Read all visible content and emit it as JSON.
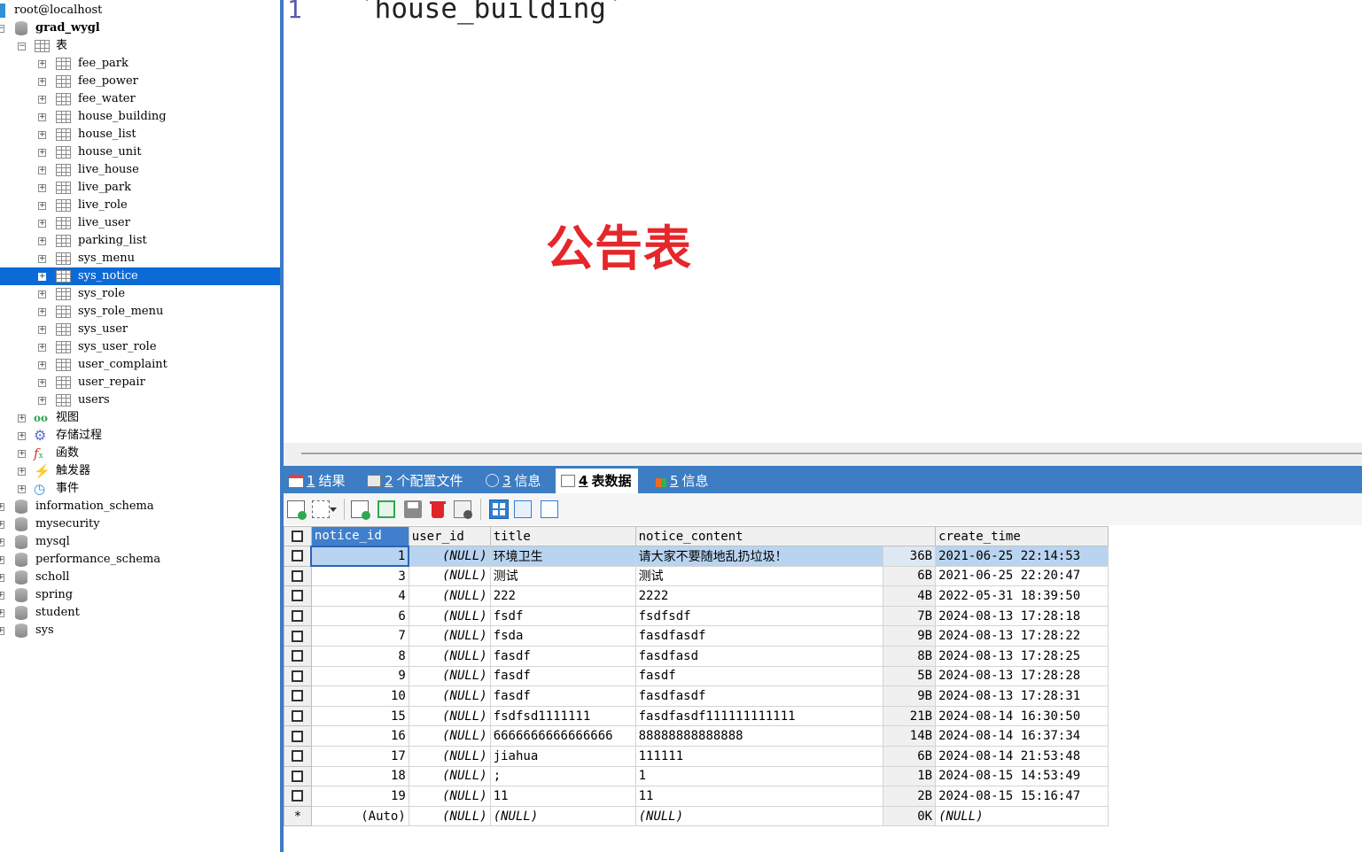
{
  "tree": {
    "connection": "root@localhost",
    "database": "grad_wygl",
    "tables_folder": "表",
    "tables": [
      "fee_park",
      "fee_power",
      "fee_water",
      "house_building",
      "house_list",
      "house_unit",
      "live_house",
      "live_park",
      "live_role",
      "live_user",
      "parking_list",
      "sys_menu",
      "sys_notice",
      "sys_role",
      "sys_role_menu",
      "sys_user",
      "sys_user_role",
      "user_complaint",
      "user_repair",
      "users"
    ],
    "selected_table": "sys_notice",
    "folders": [
      {
        "label": "视图",
        "icon": "view-icon"
      },
      {
        "label": "存储过程",
        "icon": "gear-icon"
      },
      {
        "label": "函数",
        "icon": "function-icon"
      },
      {
        "label": "触发器",
        "icon": "lightning-icon"
      },
      {
        "label": "事件",
        "icon": "clock-icon"
      }
    ],
    "other_databases": [
      "information_schema",
      "mysecurity",
      "mysql",
      "performance_schema",
      "scholl",
      "spring",
      "student",
      "sys"
    ]
  },
  "editor": {
    "line_number": "1",
    "sql": "`house_building`",
    "annotation": "公告表"
  },
  "tabs": [
    {
      "num": "1",
      "label": "结果",
      "icon": "result-grid-icon"
    },
    {
      "num": "2",
      "label": "个配置文件",
      "icon": "profile-icon"
    },
    {
      "num": "3",
      "label": "信息",
      "icon": "info-icon"
    },
    {
      "num": "4",
      "label": "表数据",
      "icon": "table-data-icon",
      "active": true
    },
    {
      "num": "5",
      "label": "信息",
      "icon": "info-chart-icon"
    }
  ],
  "toolbar": {
    "icons": [
      "add-row-icon",
      "copy-row-dropdown-icon",
      "insert-row-icon",
      "duplicate-icon",
      "save-icon",
      "delete-icon",
      "discard-icon",
      "grid-view-icon",
      "form-view-icon",
      "text-view-icon"
    ]
  },
  "grid": {
    "columns": [
      "notice_id",
      "user_id",
      "title",
      "notice_content",
      "create_time"
    ],
    "rows": [
      {
        "notice_id": "1",
        "user_id": "(NULL)",
        "title": "环境卫生",
        "notice_content": "请大家不要随地乱扔垃圾！",
        "size": "36B",
        "create_time": "2021-06-25 22:14:53"
      },
      {
        "notice_id": "3",
        "user_id": "(NULL)",
        "title": "测试",
        "notice_content": "测试",
        "size": "6B",
        "create_time": "2021-06-25 22:20:47"
      },
      {
        "notice_id": "4",
        "user_id": "(NULL)",
        "title": "222",
        "notice_content": "2222",
        "size": "4B",
        "create_time": "2022-05-31 18:39:50"
      },
      {
        "notice_id": "6",
        "user_id": "(NULL)",
        "title": "fsdf",
        "notice_content": "fsdfsdf",
        "size": "7B",
        "create_time": "2024-08-13 17:28:18"
      },
      {
        "notice_id": "7",
        "user_id": "(NULL)",
        "title": "fsda",
        "notice_content": "fasdfasdf",
        "size": "9B",
        "create_time": "2024-08-13 17:28:22"
      },
      {
        "notice_id": "8",
        "user_id": "(NULL)",
        "title": "fasdf",
        "notice_content": "fasdfasd",
        "size": "8B",
        "create_time": "2024-08-13 17:28:25"
      },
      {
        "notice_id": "9",
        "user_id": "(NULL)",
        "title": "fasdf",
        "notice_content": "fasdf",
        "size": "5B",
        "create_time": "2024-08-13 17:28:28"
      },
      {
        "notice_id": "10",
        "user_id": "(NULL)",
        "title": "fasdf",
        "notice_content": "fasdfasdf",
        "size": "9B",
        "create_time": "2024-08-13 17:28:31"
      },
      {
        "notice_id": "15",
        "user_id": "(NULL)",
        "title": "fsdfsd1111111",
        "notice_content": "fasdfasdf111111111111",
        "size": "21B",
        "create_time": "2024-08-14 16:30:50"
      },
      {
        "notice_id": "16",
        "user_id": "(NULL)",
        "title": "6666666666666666",
        "notice_content": "88888888888888",
        "size": "14B",
        "create_time": "2024-08-14 16:37:34"
      },
      {
        "notice_id": "17",
        "user_id": "(NULL)",
        "title": "jiahua",
        "notice_content": "111111",
        "size": "6B",
        "create_time": "2024-08-14 21:53:48"
      },
      {
        "notice_id": "18",
        "user_id": "(NULL)",
        "title": ";",
        "notice_content": "1",
        "size": "1B",
        "create_time": "2024-08-15 14:53:49"
      },
      {
        "notice_id": "19",
        "user_id": "(NULL)",
        "title": "11",
        "notice_content": "11",
        "size": "2B",
        "create_time": "2024-08-15 15:16:47"
      }
    ],
    "new_row": {
      "marker": "*",
      "notice_id": "(Auto)",
      "user_id": "(NULL)",
      "title": "(NULL)",
      "notice_content": "(NULL)",
      "size": "0K",
      "create_time": "(NULL)"
    }
  }
}
